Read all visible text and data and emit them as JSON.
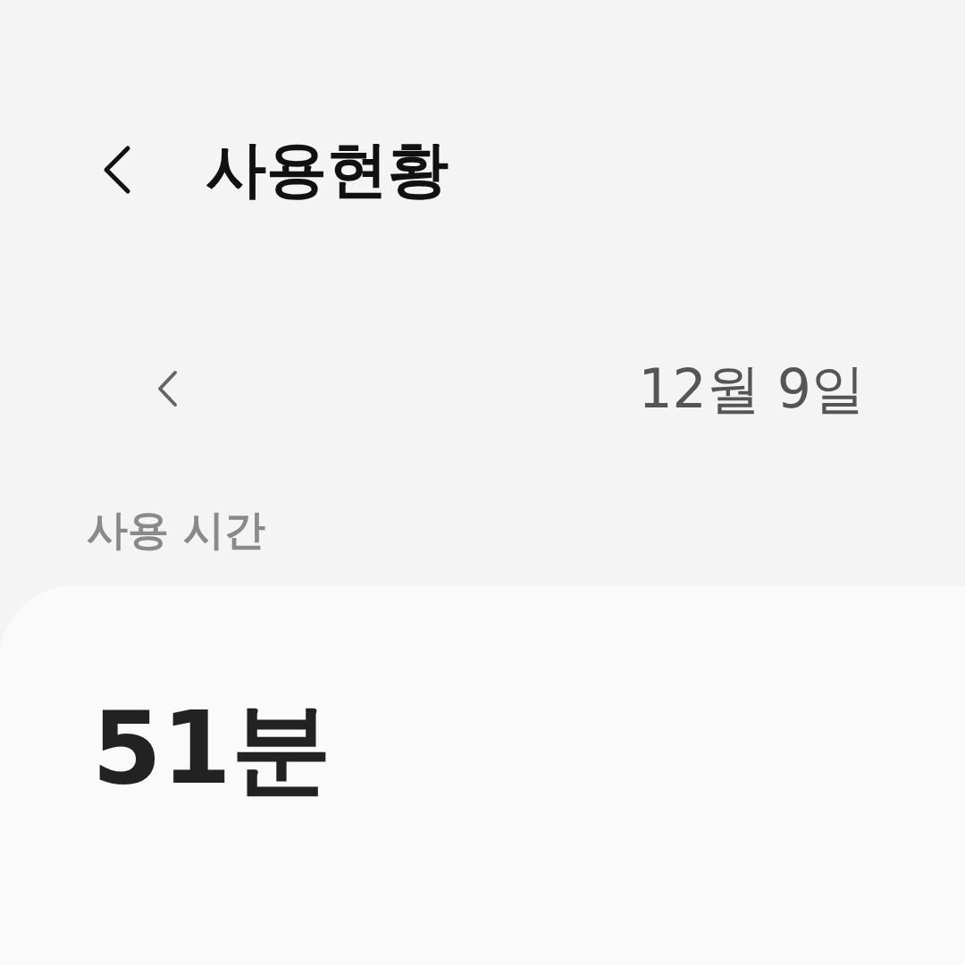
{
  "header": {
    "title": "사용현황"
  },
  "date_nav": {
    "date": "12월 9일"
  },
  "usage": {
    "label": "사용 시간",
    "total": "51분"
  }
}
